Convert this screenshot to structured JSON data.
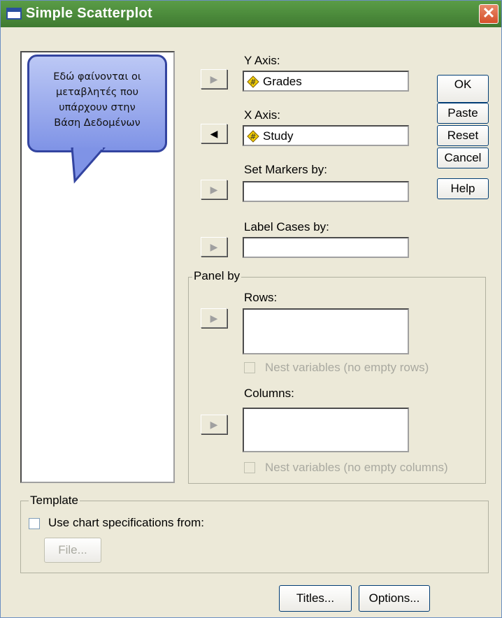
{
  "window": {
    "title": "Simple Scatterplot",
    "close_glyph": "✕"
  },
  "callout": {
    "lines": [
      "Εδώ φαίνονται οι",
      "μεταβλητές που",
      "υπάρχουν στην",
      "Βάση Δεδομένων"
    ]
  },
  "y_axis": {
    "label": "Y Axis:",
    "value": "Grades"
  },
  "x_axis": {
    "label": "X Axis:",
    "value": "Study"
  },
  "set_markers": {
    "label": "Set Markers by:",
    "value": ""
  },
  "label_cases": {
    "label": "Label Cases by:",
    "value": ""
  },
  "panel_by": {
    "title": "Panel by",
    "rows_label": "Rows:",
    "nest_rows_label": "Nest variables (no empty rows)",
    "columns_label": "Columns:",
    "nest_columns_label": "Nest variables (no empty columns)"
  },
  "buttons": {
    "ok": "OK",
    "paste": "Paste",
    "reset": "Reset",
    "cancel": "Cancel",
    "help": "Help",
    "titles": "Titles...",
    "options": "Options..."
  },
  "template": {
    "title": "Template",
    "use_chart_label": "Use chart specifications from:",
    "file_button": "File..."
  },
  "icons": {
    "arrow_right": "▶",
    "arrow_left": "◀",
    "variable": "scale-variable-icon"
  },
  "colors": {
    "titlebar": "#4f8f3e",
    "callout_fill": "#8fa2ea",
    "callout_border": "#3344a0",
    "close": "#d4502a"
  }
}
